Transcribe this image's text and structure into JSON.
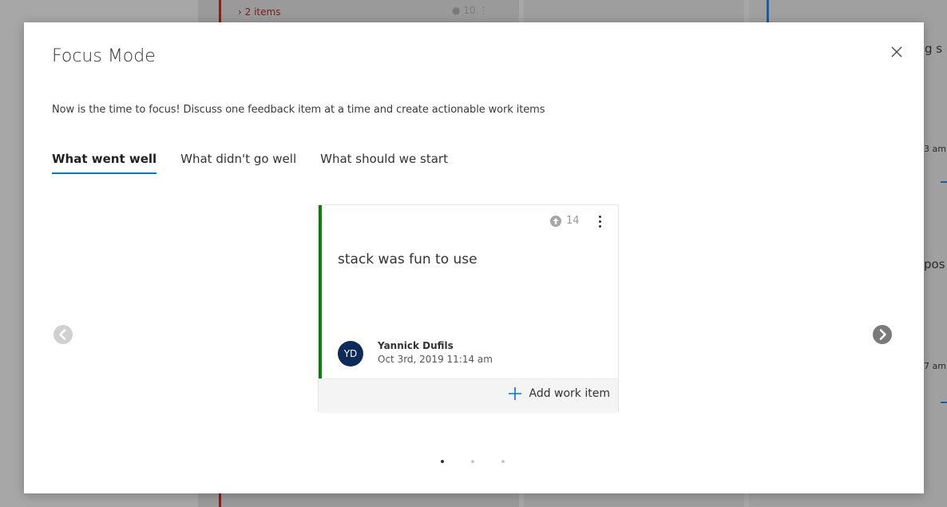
{
  "background": {
    "column_header_items": "2 items",
    "column_header_votes": "10",
    "side_fragments": [
      "g s",
      "3 am",
      "pos",
      "7 am"
    ]
  },
  "modal": {
    "title": "Focus Mode",
    "subtitle": "Now is the time to focus! Discuss one feedback item at a time and create actionable work items",
    "close_icon": "close-icon",
    "tabs": [
      {
        "label": "What went well",
        "active": true
      },
      {
        "label": "What didn't go well",
        "active": false
      },
      {
        "label": "What should we start",
        "active": false
      }
    ]
  },
  "card": {
    "accent_color": "#107c10",
    "vote_icon": "upvote-icon",
    "votes": "14",
    "text": "stack was fun to use",
    "avatar_initials": "YD",
    "avatar_color": "#0e2a5a",
    "author": "Yannick Dufils",
    "timestamp": "Oct 3rd, 2019 11:14 am",
    "add_work_item_label": "Add work item"
  },
  "pagination": {
    "current": 1,
    "total": 3
  },
  "colors": {
    "accent_blue": "#0078d4",
    "nav_arrow": "#c8c8c8"
  }
}
